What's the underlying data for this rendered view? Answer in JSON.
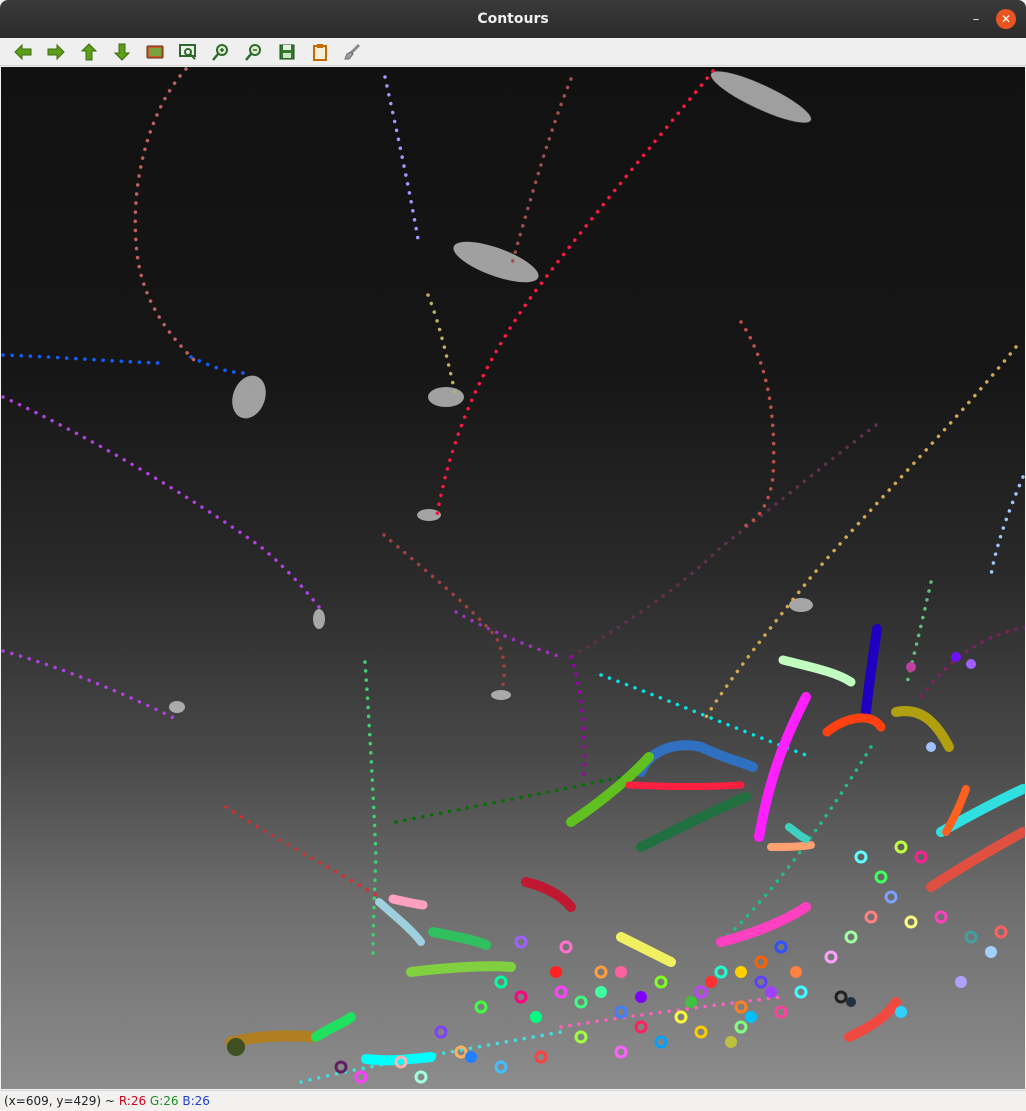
{
  "window": {
    "title": "Contours",
    "minimize_glyph": "–",
    "close_glyph": "✕"
  },
  "toolbar": {
    "buttons": [
      {
        "icon": "arrow-left-icon"
      },
      {
        "icon": "arrow-right-icon"
      },
      {
        "icon": "arrow-up-icon"
      },
      {
        "icon": "arrow-down-icon"
      },
      {
        "icon": "image-icon"
      },
      {
        "icon": "zoom-fit-icon"
      },
      {
        "icon": "zoom-in-icon"
      },
      {
        "icon": "zoom-out-icon"
      },
      {
        "icon": "save-icon"
      },
      {
        "icon": "clipboard-icon"
      },
      {
        "icon": "brush-icon"
      }
    ],
    "icon_color": "#5a9e1a"
  },
  "status": {
    "coords": "(x=609, y=429) ~",
    "r": "R:26",
    "g": "G:26",
    "b": "B:26"
  }
}
